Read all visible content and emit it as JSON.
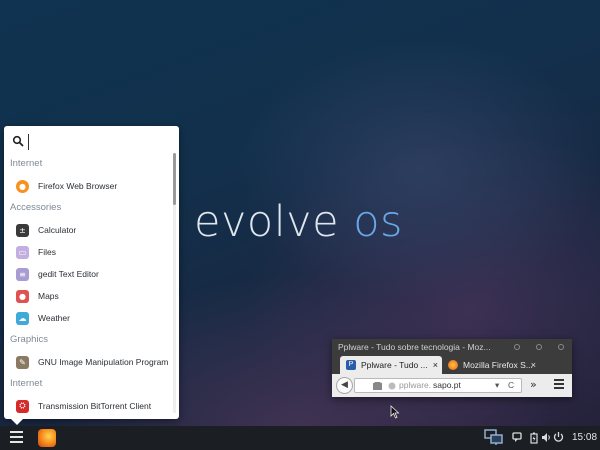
{
  "desktop": {
    "brand_word1": "evolve",
    "brand_word2": "os"
  },
  "menu": {
    "search": {
      "value": "",
      "icon": "search-icon"
    },
    "sections": [
      {
        "label": "Internet",
        "items": [
          {
            "label": "Firefox Web Browser",
            "icon": "firefox-icon",
            "color": "#f7921e"
          }
        ]
      },
      {
        "label": "Accessories",
        "items": [
          {
            "label": "Calculator",
            "icon": "calculator-icon",
            "color": "#3a3a3a"
          },
          {
            "label": "Files",
            "icon": "files-icon",
            "color": "#b8a0d8"
          },
          {
            "label": "gedit Text Editor",
            "icon": "text-editor-icon",
            "color": "#9c90c8"
          },
          {
            "label": "Maps",
            "icon": "maps-icon",
            "color": "#e05252"
          },
          {
            "label": "Weather",
            "icon": "weather-icon",
            "color": "#3fa9d9"
          }
        ]
      },
      {
        "label": "Graphics",
        "items": [
          {
            "label": "GNU Image Manipulation Program",
            "icon": "gimp-icon",
            "color": "#8a7a62"
          }
        ]
      },
      {
        "label": "Internet",
        "items": [
          {
            "label": "Transmission BitTorrent Client",
            "icon": "transmission-icon",
            "color": "#d62b2b"
          }
        ]
      }
    ]
  },
  "firefox_window": {
    "title": "Pplware - Tudo sobre tecnologia - Moz...",
    "tabs": [
      {
        "label": "Pplware - Tudo ...",
        "icon": "pplware-favicon",
        "active": true,
        "close": "×"
      },
      {
        "label": "Mozilla Firefox S...",
        "icon": "firefox-favicon",
        "active": false,
        "close": "×"
      }
    ],
    "new_tab": "+",
    "url_prefix": "pplware.",
    "url_domain": "sapo.pt",
    "reload": "C",
    "overflow": "»"
  },
  "panel": {
    "clock": "15:08",
    "accent": "#6aa7e6"
  }
}
